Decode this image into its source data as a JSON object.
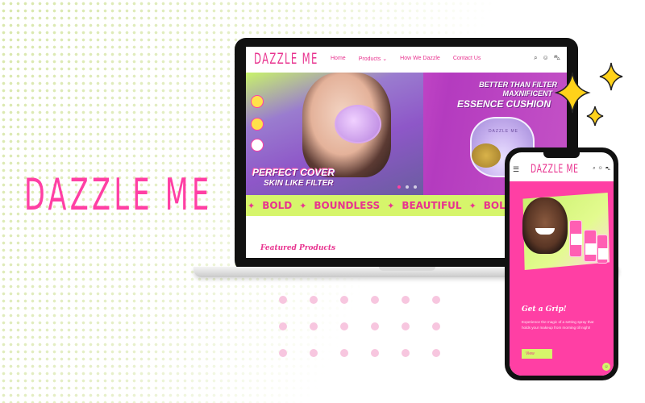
{
  "brand": "DAZZLE ME",
  "desktop": {
    "logo": "DAZZLE ME",
    "nav": [
      "Home",
      "Products",
      "How We Dazzle",
      "Contact Us"
    ],
    "nav_products_caret": "⌄",
    "icons": [
      "search-icon",
      "account-icon",
      "cart-icon"
    ],
    "hero": {
      "headline_1": "BETTER THAN FILTER",
      "headline_2": "MAXNIFICENT",
      "headline_3": "ESSENCE CUSHION",
      "product_label": "DAZZLE ME",
      "slogan_1": "PERFECT COVER",
      "slogan_2": "SKIN LIKE FILTER",
      "slide_count": 3,
      "active_slide": 1
    },
    "marquee": [
      "BOLD",
      "BOUNDLESS",
      "BEAUTIFUL",
      "BOLD"
    ],
    "marquee_separator": "✦",
    "featured_title": "Featured Products"
  },
  "mobile": {
    "menu_glyph": "☰",
    "logo": "DAZZLE ME",
    "icons": [
      "search-icon",
      "account-icon",
      "cart-icon"
    ],
    "title": "Get a Grip!",
    "text": "Experience the magic of a setting spray that holds your makeup from morning till night!",
    "button": "View",
    "fab_glyph": "☺"
  },
  "colors": {
    "brand_pink": "#ff3fa4",
    "accent_lime": "#d6f56b",
    "sparkle_yellow": "#ffd21a"
  }
}
